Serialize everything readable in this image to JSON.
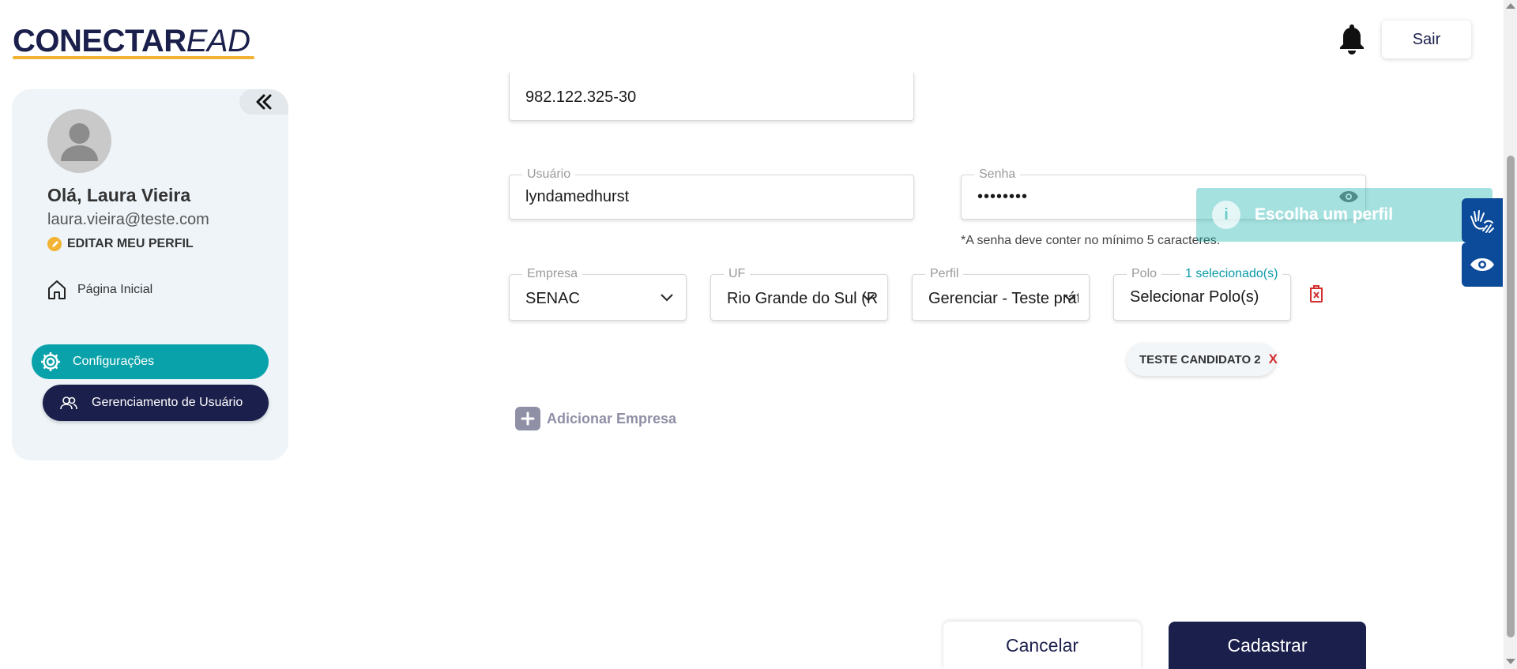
{
  "header": {
    "logo_bold": "CONECTAR",
    "logo_italic": "EAD",
    "logout_label": "Sair",
    "brand_color": "#1b1f4b",
    "accent_color": "#f2b233"
  },
  "sidebar": {
    "greeting": "Olá, Laura Vieira",
    "email": "laura.vieira@teste.com",
    "edit_profile_label": "EDITAR MEU PERFIL",
    "nav": {
      "home_label": "Página Inicial",
      "config_label": "Configurações",
      "user_mgmt_label": "Gerenciamento de Usuário"
    },
    "config_color": "#0aa2aa"
  },
  "form": {
    "cpf": {
      "value": "982.122.325-30"
    },
    "usuario": {
      "label": "Usuário",
      "value": "lyndamedhurst"
    },
    "senha": {
      "label": "Senha",
      "value": "••••••••",
      "hint": "*A senha deve conter no mínimo 5 caracteres."
    },
    "empresa": {
      "label": "Empresa",
      "value": "SENAC"
    },
    "uf": {
      "label": "UF",
      "value": "Rio Grande do Sul (RS)"
    },
    "perfil": {
      "label": "Perfil",
      "value": "Gerenciar - Teste prático"
    },
    "polo": {
      "label": "Polo",
      "selected_count": "1 selecionado(s)",
      "value": "Selecionar Polo(s)"
    },
    "chips": [
      {
        "label": "TESTE CANDIDATO 2",
        "remove": "X"
      }
    ],
    "add_company_label": "Adicionar Empresa",
    "cancel_label": "Cancelar",
    "submit_label": "Cadastrar"
  },
  "toast": {
    "icon": "i",
    "message": "Escolha um perfil"
  }
}
